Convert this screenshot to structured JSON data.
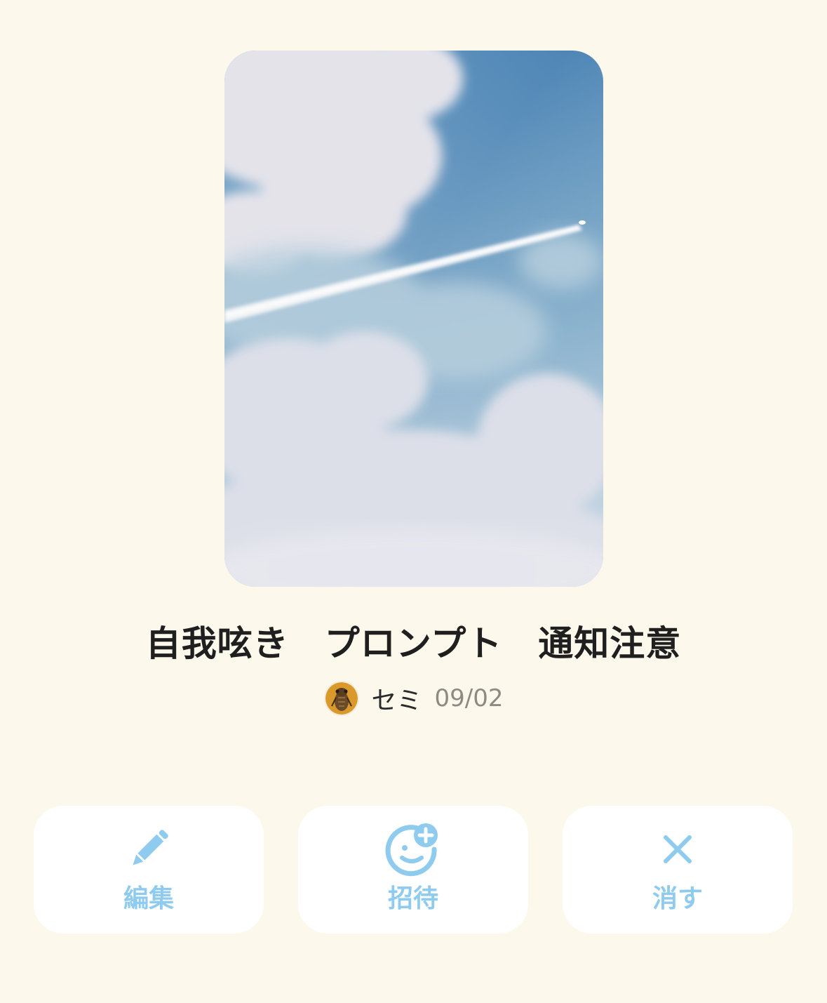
{
  "post": {
    "title": "自我呟き　プロンプト　通知注意",
    "author": "セミ",
    "date": "09/02",
    "cover_image": "sky-with-contrail-photo",
    "avatar_image": "cicada-avatar"
  },
  "actions": [
    {
      "label": "編集",
      "icon": "pencil-icon"
    },
    {
      "label": "招待",
      "icon": "invite-smiley-plus-icon"
    },
    {
      "label": "消す",
      "icon": "close-x-icon"
    }
  ],
  "colors": {
    "background": "#fdf8ec",
    "button_bg": "#ffffff",
    "accent": "#8ecbef",
    "title_text": "#1f1f1f",
    "date_text": "#8d8a84"
  }
}
